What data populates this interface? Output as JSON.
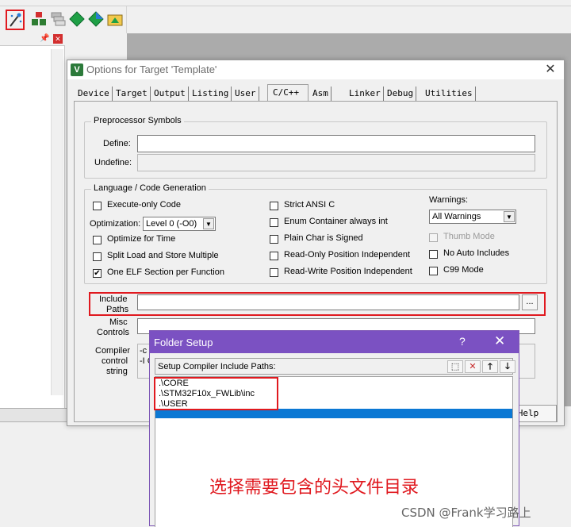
{
  "dialog": {
    "title": "Options for Target 'Template'",
    "close_glyph": "✕",
    "tabs": [
      {
        "label": "Device"
      },
      {
        "label": "Target"
      },
      {
        "label": "Output"
      },
      {
        "label": "Listing"
      },
      {
        "label": "User"
      },
      {
        "label": "C/C++"
      },
      {
        "label": "Asm"
      },
      {
        "label": "Linker"
      },
      {
        "label": "Debug"
      },
      {
        "label": "Utilities"
      }
    ],
    "active_tab": "C/C++",
    "preprocessor": {
      "group_label": "Preprocessor Symbols",
      "define_label": "Define:",
      "define_value": "",
      "undefine_label": "Undefine:",
      "undefine_value": ""
    },
    "language": {
      "group_label": "Language / Code Generation",
      "execute_only": {
        "label": "Execute-only Code",
        "checked": false
      },
      "optimization_label": "Optimization:",
      "optimization_value": "Level 0 (-O0)",
      "optimize_for_time": {
        "label": "Optimize for Time",
        "checked": false
      },
      "split_load": {
        "label": "Split Load and Store Multiple",
        "checked": false
      },
      "one_elf": {
        "label": "One ELF Section per Function",
        "checked": true
      },
      "strict_ansi": {
        "label": "Strict ANSI C",
        "checked": false
      },
      "enum_container": {
        "label": "Enum Container always int",
        "checked": false
      },
      "plain_char": {
        "label": "Plain Char is Signed",
        "checked": false
      },
      "ro_pos": {
        "label": "Read-Only Position Independent",
        "checked": false
      },
      "rw_pos": {
        "label": "Read-Write Position Independent",
        "checked": false
      },
      "warnings_label": "Warnings:",
      "warnings_value": "All Warnings",
      "thumb_mode": {
        "label": "Thumb Mode",
        "checked": false,
        "disabled": true
      },
      "no_auto_includes": {
        "label": "No Auto Includes",
        "checked": false
      },
      "c99_mode": {
        "label": "C99 Mode",
        "checked": false
      }
    },
    "include_paths": {
      "label_line1": "Include",
      "label_line2": "Paths",
      "value": "",
      "browse": "..."
    },
    "misc_controls": {
      "label_line1": "Misc",
      "label_line2": "Controls",
      "value": ""
    },
    "compiler_control": {
      "label_line1": "Compiler",
      "label_line2": "control",
      "label_line3": "string",
      "line1": "-c -",
      "line2": "-I C"
    },
    "help_button": "Help"
  },
  "folder_setup": {
    "title": "Folder Setup",
    "help_glyph": "?",
    "close_glyph": "✕",
    "header_label": "Setup Compiler Include Paths:",
    "buttons": {
      "new": "⬚",
      "delete": "✕",
      "up": "🡑",
      "down": "🡓"
    },
    "paths": [
      ".\\CORE",
      ".\\STM32F10x_FWLib\\inc",
      ".\\USER"
    ],
    "selected_row_value": ""
  },
  "annotation": "选择需要包含的头文件目录",
  "watermark": "CSDN @Frank学习路上",
  "colors": {
    "highlight_red": "#e0191f",
    "folder_title": "#7b51c2",
    "selection_blue": "#0b78d4"
  }
}
